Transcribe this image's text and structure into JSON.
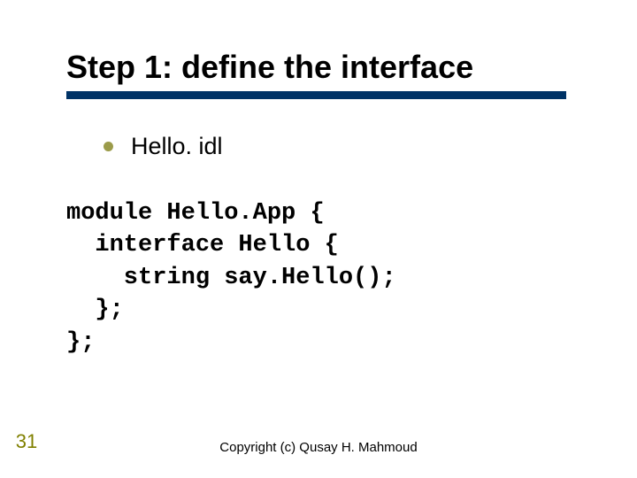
{
  "slide": {
    "title": "Step 1: define the interface",
    "bullet": "Hello. idl",
    "code": "module Hello.App {\n  interface Hello {\n    string say.Hello();\n  };\n};",
    "footer": "Copyright (c) Qusay H. Mahmoud",
    "number": "31"
  }
}
